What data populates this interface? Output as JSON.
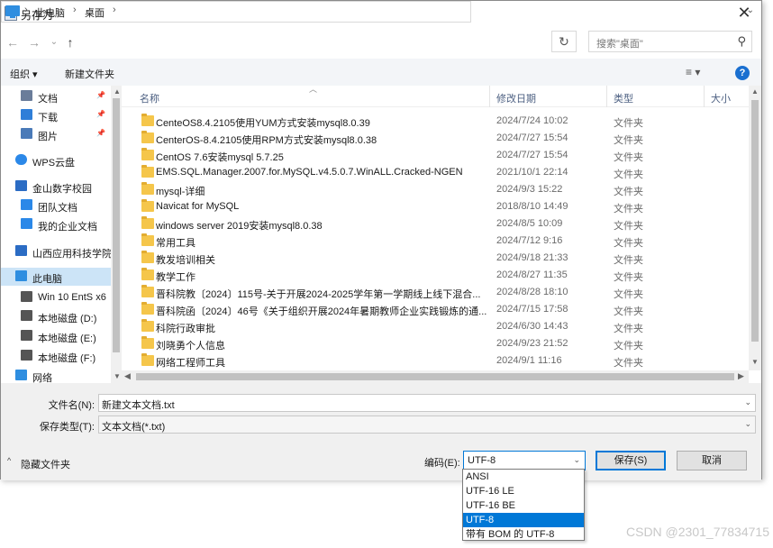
{
  "window": {
    "title": "另存为",
    "close_label": "✕"
  },
  "nav": {
    "back": "←",
    "forward": "→",
    "up": "↑",
    "history": "⌄"
  },
  "address": {
    "crumbs": [
      "此电脑",
      "桌面"
    ],
    "separator": "›",
    "refresh": "↻"
  },
  "search": {
    "placeholder": "搜索\"桌面\"",
    "icon": "search-icon"
  },
  "toolbar": {
    "organize": "组织 ▾",
    "new_folder": "新建文件夹",
    "view_icon": "≡ ▾",
    "help": "?"
  },
  "sidebar": {
    "items": [
      {
        "label": "文档",
        "icon": "documents-icon",
        "color": "#6a7d9a",
        "pinned": true
      },
      {
        "label": "下载",
        "icon": "download-icon",
        "color": "#2f7ed8",
        "pinned": true
      },
      {
        "label": "图片",
        "icon": "pictures-icon",
        "color": "#4a7ab8",
        "pinned": true
      },
      {
        "label": "WPS云盘",
        "icon": "cloud-icon",
        "color": "#2b88e8"
      },
      {
        "label": "金山数字校园",
        "icon": "building-icon",
        "color": "#2b6cc4"
      },
      {
        "label": "团队文档",
        "icon": "team-doc-icon",
        "color": "#2b88e8"
      },
      {
        "label": "我的企业文档",
        "icon": "enterprise-doc-icon",
        "color": "#2b88e8"
      },
      {
        "label": "山西应用科技学院",
        "icon": "building-icon",
        "color": "#2b6cc4"
      },
      {
        "label": "此电脑",
        "icon": "computer-icon",
        "color": "#2f8ee0",
        "selected": true
      },
      {
        "label": "Win 10 EntS x6",
        "icon": "drive-icon",
        "color": "#555555"
      },
      {
        "label": "本地磁盘 (D:)",
        "icon": "drive-icon",
        "color": "#555555"
      },
      {
        "label": "本地磁盘 (E:)",
        "icon": "drive-icon",
        "color": "#555555"
      },
      {
        "label": "本地磁盘 (F:)",
        "icon": "drive-icon",
        "color": "#555555"
      },
      {
        "label": "网络",
        "icon": "network-icon",
        "color": "#2f8ee0"
      }
    ],
    "pin_glyph": "📌"
  },
  "columns": {
    "name": "名称",
    "date": "修改日期",
    "type": "类型",
    "size": "大小"
  },
  "files": [
    {
      "name": "CenteOS8.4.2105使用YUM方式安装mysql8.0.39",
      "date": "2024/7/24 10:02",
      "type": "文件夹"
    },
    {
      "name": "CenterOS-8.4.2105使用RPM方式安装mysql8.0.38",
      "date": "2024/7/27 15:54",
      "type": "文件夹"
    },
    {
      "name": "CentOS 7.6安装mysql 5.7.25",
      "date": "2024/7/27 15:54",
      "type": "文件夹"
    },
    {
      "name": "EMS.SQL.Manager.2007.for.MySQL.v4.5.0.7.WinALL.Cracked-NGEN",
      "date": "2021/10/1 22:14",
      "type": "文件夹"
    },
    {
      "name": "mysql-详细",
      "date": "2024/9/3 15:22",
      "type": "文件夹"
    },
    {
      "name": "Navicat for MySQL",
      "date": "2018/8/10 14:49",
      "type": "文件夹"
    },
    {
      "name": "windows server 2019安装mysql8.0.38",
      "date": "2024/8/5 10:09",
      "type": "文件夹"
    },
    {
      "name": "常用工具",
      "date": "2024/7/12 9:16",
      "type": "文件夹"
    },
    {
      "name": "教发培训相关",
      "date": "2024/9/18 21:33",
      "type": "文件夹"
    },
    {
      "name": "教学工作",
      "date": "2024/8/27 11:35",
      "type": "文件夹"
    },
    {
      "name": "晋科院教〔2024〕115号-关于开展2024-2025学年第一学期线上线下混合...",
      "date": "2024/8/28 18:10",
      "type": "文件夹"
    },
    {
      "name": "晋科院函〔2024〕46号《关于组织开展2024年暑期教师企业实践锻炼的通...",
      "date": "2024/7/15 17:58",
      "type": "文件夹"
    },
    {
      "name": "科院行政审批",
      "date": "2024/6/30 14:43",
      "type": "文件夹"
    },
    {
      "name": "刘晓勇个人信息",
      "date": "2024/9/23 21:52",
      "type": "文件夹"
    },
    {
      "name": "网络工程师工具",
      "date": "2024/9/1 11:16",
      "type": "文件夹"
    }
  ],
  "form": {
    "filename_label": "文件名(N):",
    "filename_value": "新建文本文档.txt",
    "filetype_label": "保存类型(T):",
    "filetype_value": "文本文档(*.txt)",
    "hide_folders": "隐藏文件夹",
    "encoding_label": "编码(E):",
    "encoding_value": "UTF-8",
    "save": "保存(S)",
    "cancel": "取消"
  },
  "encoding_options": [
    "ANSI",
    "UTF-16 LE",
    "UTF-16 BE",
    "UTF-8",
    "带有 BOM 的 UTF-8"
  ],
  "encoding_selected": "UTF-8",
  "watermark": "CSDN @2301_77834715"
}
